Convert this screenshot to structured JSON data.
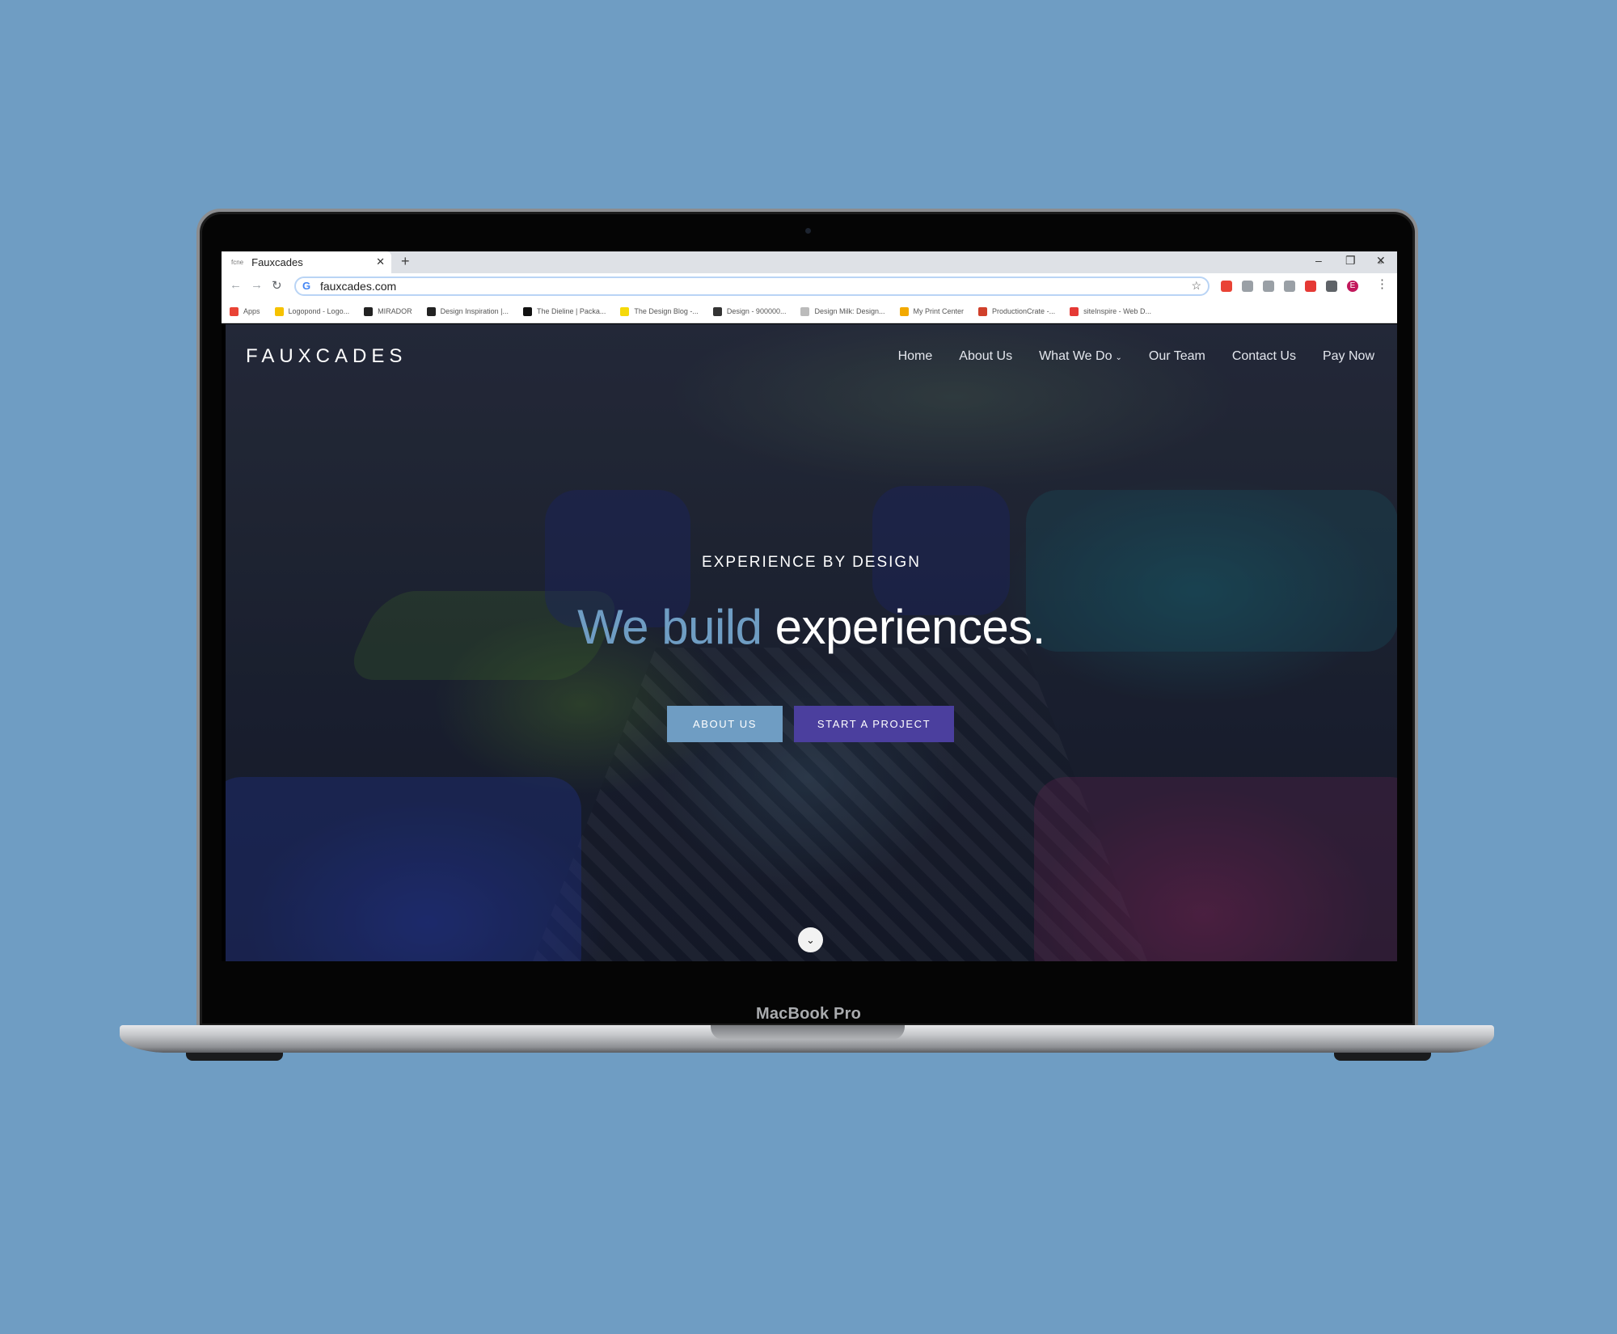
{
  "device": {
    "label": "MacBook Pro"
  },
  "browser": {
    "tab_title": "Fauxcades",
    "tab_favicon_text": "fcne",
    "new_tab_icon": "plus-icon",
    "url": "fauxcades.com",
    "bookmarks": [
      {
        "label": "Apps",
        "color": "#e94335"
      },
      {
        "label": "Logopond - Logo...",
        "color": "#f6c200"
      },
      {
        "label": "MIRADOR",
        "color": "#222222"
      },
      {
        "label": "Design Inspiration |...",
        "color": "#222222"
      },
      {
        "label": "The Dieline | Packa...",
        "color": "#111111"
      },
      {
        "label": "The Design Blog -...",
        "color": "#f5d90a"
      },
      {
        "label": "Design - 900000...",
        "color": "#333333"
      },
      {
        "label": "Design Milk: Design...",
        "color": "#bbbbbb"
      },
      {
        "label": "My Print Center",
        "color": "#f2a900"
      },
      {
        "label": "ProductionCrate -...",
        "color": "#d0402b"
      },
      {
        "label": "siteInspire - Web D...",
        "color": "#e53935"
      }
    ],
    "bookmarks_more": "»",
    "avatar_letter": "E",
    "colors": {
      "omnibox_focus": "#b9d4f5"
    }
  },
  "site": {
    "logo": "FAUXCADES",
    "nav": [
      {
        "label": "Home"
      },
      {
        "label": "About Us"
      },
      {
        "label": "What We Do",
        "has_dropdown": true
      },
      {
        "label": "Our Team"
      },
      {
        "label": "Contact Us"
      },
      {
        "label": "Pay Now"
      }
    ],
    "hero": {
      "kicker": "EXPERIENCE BY DESIGN",
      "headline_part1": "We build",
      "headline_part2": "experiences.",
      "button_primary": "ABOUT US",
      "button_secondary": "START A PROJECT"
    },
    "colors": {
      "accent_blue": "#6f9dc3",
      "accent_purple": "#4b3f9e",
      "page_background": "#6f9dc3"
    }
  }
}
